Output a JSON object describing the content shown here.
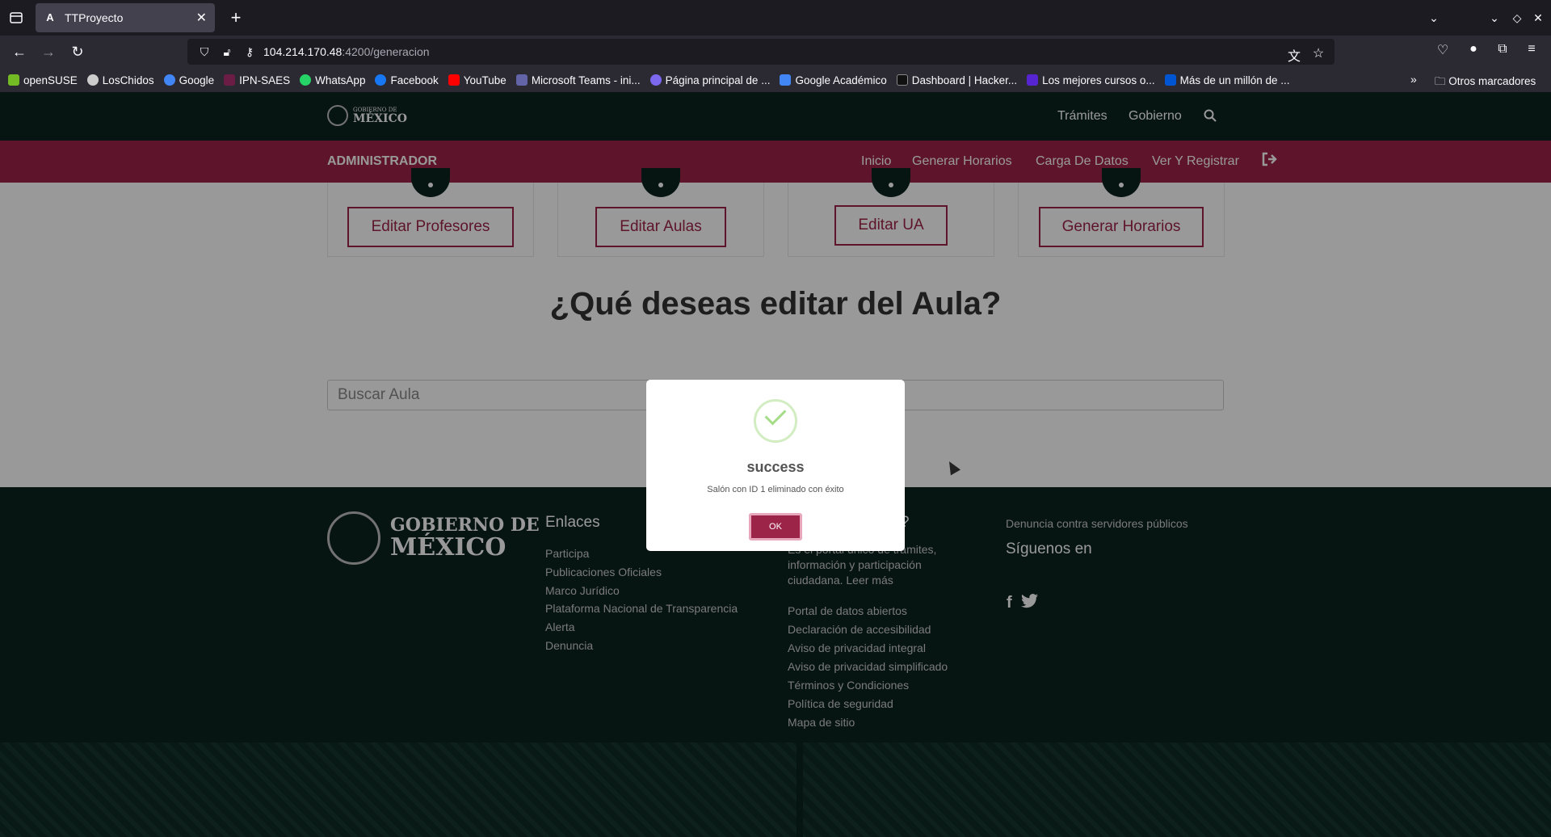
{
  "browser": {
    "tab_title": "TTProyecto",
    "tab_favicon": "A",
    "url_host": "104.214.170.48",
    "url_path": ":4200/generacion",
    "bookmarks": [
      {
        "label": "openSUSE",
        "color": "#73ba25"
      },
      {
        "label": "LosChidos",
        "color": "#cccccc"
      },
      {
        "label": "Google",
        "color": "#4285f4"
      },
      {
        "label": "IPN-SAES",
        "color": "#6c1d45"
      },
      {
        "label": "WhatsApp",
        "color": "#25d366"
      },
      {
        "label": "Facebook",
        "color": "#1877f2"
      },
      {
        "label": "YouTube",
        "color": "#ff0000"
      },
      {
        "label": "Microsoft Teams - ini...",
        "color": "#6264a7"
      },
      {
        "label": "Página principal de ...",
        "color": "#7b68ee"
      },
      {
        "label": "Google Académico",
        "color": "#4285f4"
      },
      {
        "label": "Dashboard | Hacker...",
        "color": "#111111"
      },
      {
        "label": "Los mejores cursos o...",
        "color": "#5624d0"
      },
      {
        "label": "Más de un millón de ...",
        "color": "#0056d2"
      }
    ],
    "bookmarks_other": "Otros marcadores"
  },
  "gov_header": {
    "logo_small": "GOBIERNO DE",
    "logo_big": "MÉXICO",
    "nav": [
      "Trámites",
      "Gobierno"
    ]
  },
  "admin_bar": {
    "title": "ADMINISTRADOR",
    "links": [
      "Inicio",
      "Generar Horarios",
      "Carga De Datos",
      "Ver Y Registrar"
    ]
  },
  "cards": [
    "Editar Profesores",
    "Editar Aulas",
    "Editar UA",
    "Generar Horarios"
  ],
  "main": {
    "title": "¿Qué deseas editar del Aula?",
    "search_placeholder": "Buscar Aula"
  },
  "footer": {
    "logo_line1": "GOBIERNO DE",
    "logo_line2": "MÉXICO",
    "enlaces_title": "Enlaces",
    "enlaces": [
      "Participa",
      "Publicaciones Oficiales",
      "Marco Jurídico",
      "Plataforma Nacional de Transparencia",
      "Alerta",
      "Denuncia"
    ],
    "que_es_title_tail": "?",
    "que_es_text": "Es el portal único de trámites, información y participación ciudadana. Leer más",
    "links2": [
      "Portal de datos abiertos",
      "Declaración de accesibilidad",
      "Aviso de privacidad integral",
      "Aviso de privacidad simplificado",
      "Términos y Condiciones",
      "Política de seguridad",
      "Mapa de sitio"
    ],
    "denuncia": "Denuncia contra servidores públicos",
    "siguenos": "Síguenos en"
  },
  "modal": {
    "title": "success",
    "text": "Salón con ID 1 eliminado con éxito",
    "ok": "OK",
    "accent": "#9d2449",
    "check_color": "#a5dc86"
  }
}
